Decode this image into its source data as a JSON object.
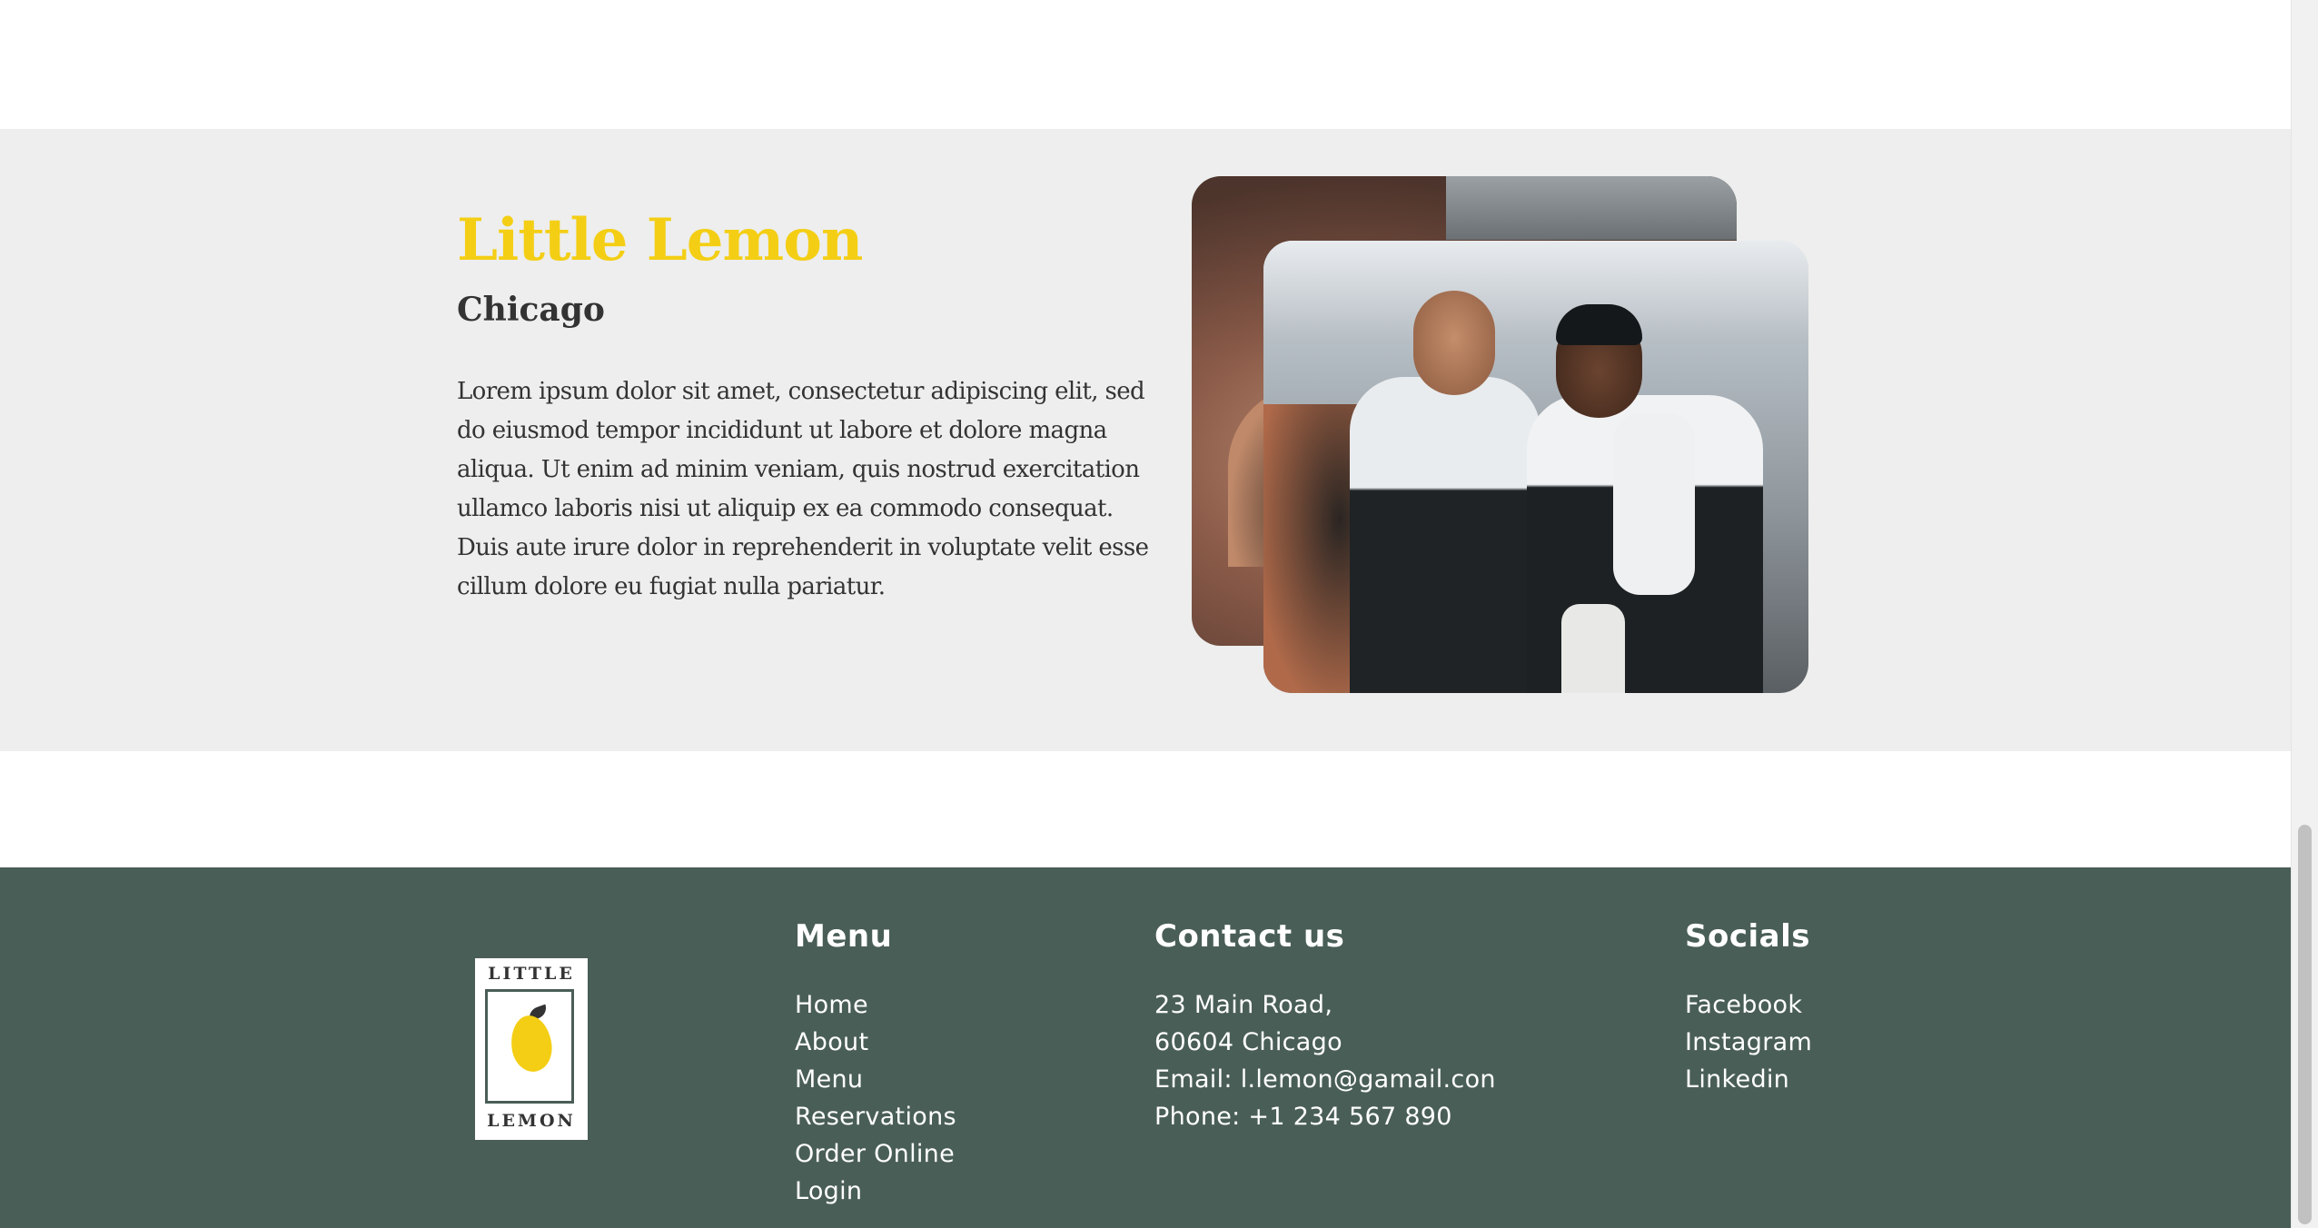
{
  "about": {
    "title": "Little Lemon",
    "subtitle": "Chicago",
    "body": "Lorem ipsum dolor sit amet, consectetur adipiscing elit, sed do eiusmod tempor incididunt ut labore et dolore magna aliqua. Ut enim ad minim veniam, quis nostrud exercitation ullamco laboris nisi ut aliquip ex ea commodo consequat. Duis aute irure dolor in reprehenderit in voluptate velit esse cillum dolore eu fugiat nulla pariatur."
  },
  "footer": {
    "logo": {
      "top": "LITTLE",
      "bottom": "LEMON"
    },
    "menu": {
      "title": "Menu",
      "items": [
        "Home",
        "About",
        "Menu",
        "Reservations",
        "Order Online",
        "Login"
      ]
    },
    "contact": {
      "title": "Contact us",
      "lines": [
        "23 Main Road,",
        "60604 Chicago",
        "Email: l.lemon@gamail.con",
        "Phone: +1 234 567 890"
      ]
    },
    "socials": {
      "title": "Socials",
      "items": [
        "Facebook",
        "Instagram",
        "Linkedin"
      ]
    }
  },
  "colors": {
    "primary_green": "#495e57",
    "primary_yellow": "#f4ce14",
    "section_gray": "#edeeed",
    "text_dark": "#333333"
  },
  "icons": {
    "logo": "lemon-logo-icon"
  }
}
